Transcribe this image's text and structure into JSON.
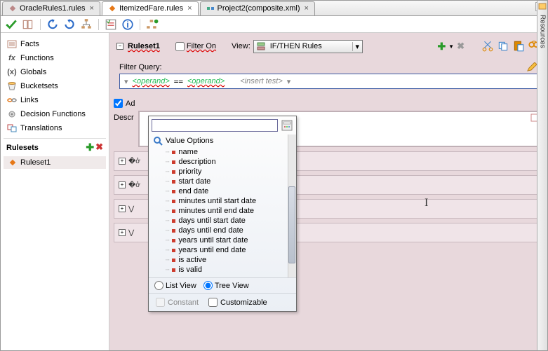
{
  "tabs": [
    {
      "label": "OracleRules1.rules",
      "icon": "diamond-gray"
    },
    {
      "label": "ItemizedFare.rules",
      "icon": "diamond-orange"
    },
    {
      "label": "Project2(composite.xml)",
      "icon": "flow"
    }
  ],
  "sidebar": {
    "items": [
      {
        "label": "Facts",
        "icon": "facts"
      },
      {
        "label": "Functions",
        "icon": "fx"
      },
      {
        "label": "Globals",
        "icon": "x"
      },
      {
        "label": "Bucketsets",
        "icon": "bucket"
      },
      {
        "label": "Links",
        "icon": "link"
      },
      {
        "label": "Decision Functions",
        "icon": "gear"
      },
      {
        "label": "Translations",
        "icon": "trans"
      }
    ],
    "rulesets_label": "Rulesets",
    "ruleset_item": "Ruleset1"
  },
  "ruleset_header": {
    "name": "Ruleset1",
    "filter_on": "Filter On",
    "view": "View:",
    "view_value": "IF/THEN Rules"
  },
  "filter": {
    "label": "Filter Query:",
    "operand": "<operand>",
    "eq": "==",
    "insert": "<insert test>"
  },
  "ad_label": "Ad",
  "descr_label": "Descr",
  "popup": {
    "search_value": "",
    "title": "Value Options",
    "items": [
      "name",
      "description",
      "priority",
      "start date",
      "end date",
      "minutes until start date",
      "minutes until end date",
      "days until start date",
      "days until end date",
      "years until start date",
      "years until end date",
      "is active",
      "is valid"
    ],
    "list_view": "List View",
    "tree_view": "Tree View",
    "constant": "Constant",
    "customizable": "Customizable"
  },
  "rside": "Resources"
}
